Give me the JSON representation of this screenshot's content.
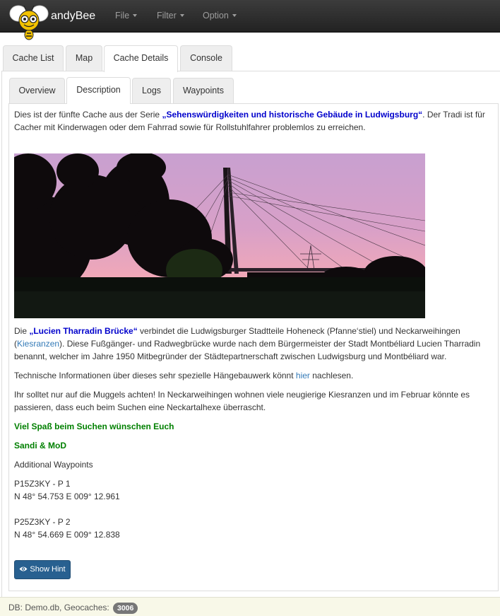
{
  "navbar": {
    "brand": "andyBee",
    "menus": [
      "File",
      "Filter",
      "Option"
    ]
  },
  "main_tabs": [
    "Cache List",
    "Map",
    "Cache Details",
    "Console"
  ],
  "detail_tabs": [
    "Overview",
    "Description",
    "Logs",
    "Waypoints"
  ],
  "description": {
    "intro_1": "Dies ist der fünfte Cache aus der Serie ",
    "intro_series": "„Sehenswürdigkeiten und historische Gebäude in Ludwigsburg“",
    "intro_2": ". Der Tradi ist für Cacher mit Kinderwagen oder dem Fahrrad sowie für Rollstuhlfahrer problemlos zu erreichen.",
    "bridge_1": "Die ",
    "bridge_name": "„Lucien Tharradin Brücke“",
    "bridge_2": " verbindet die Ludwigsburger Stadtteile Hoheneck (Pfanne‘stiel) und Neckarweihingen (",
    "bridge_link": "Kiesranzen",
    "bridge_3": "). Diese Fußgänger- und Radwegbrücke wurde nach dem Bürgermeister der Stadt Montbéliard Lucien Tharradin benannt, welcher im Jahre 1950 Mitbegründer der Städtepartnerschaft zwischen Ludwigsburg und Montbéliard war.",
    "tech_1": "Technische Informationen über dieses sehr spezielle Hängebauwerk könnt ",
    "tech_link": "hier",
    "tech_2": " nachlesen.",
    "muggels": "Ihr solltet nur auf die Muggels achten! In Neckarweihingen wohnen viele neugierige Kiesranzen und im Februar könnte es passieren, dass euch beim Suchen eine Neckartalhexe überrascht.",
    "greeting": "Viel Spaß beim Suchen wünschen Euch",
    "signature": "Sandi & MoD",
    "additional": "Additional Waypoints",
    "waypoints": [
      {
        "name": "P15Z3KY - P 1",
        "coords": "N 48° 54.753 E 009° 12.961"
      },
      {
        "name": "P25Z3KY - P 2",
        "coords": "N 48° 54.669 E 009° 12.838"
      }
    ]
  },
  "hint_button": "Show Hint",
  "footer": {
    "text": "DB: Demo.db, Geocaches:",
    "count": "3006"
  },
  "colors": {
    "navbar": "#222222",
    "series_link": "#0000cc",
    "green_text": "#008000",
    "button": "#286090",
    "footer_bg": "#f8f8e8"
  }
}
